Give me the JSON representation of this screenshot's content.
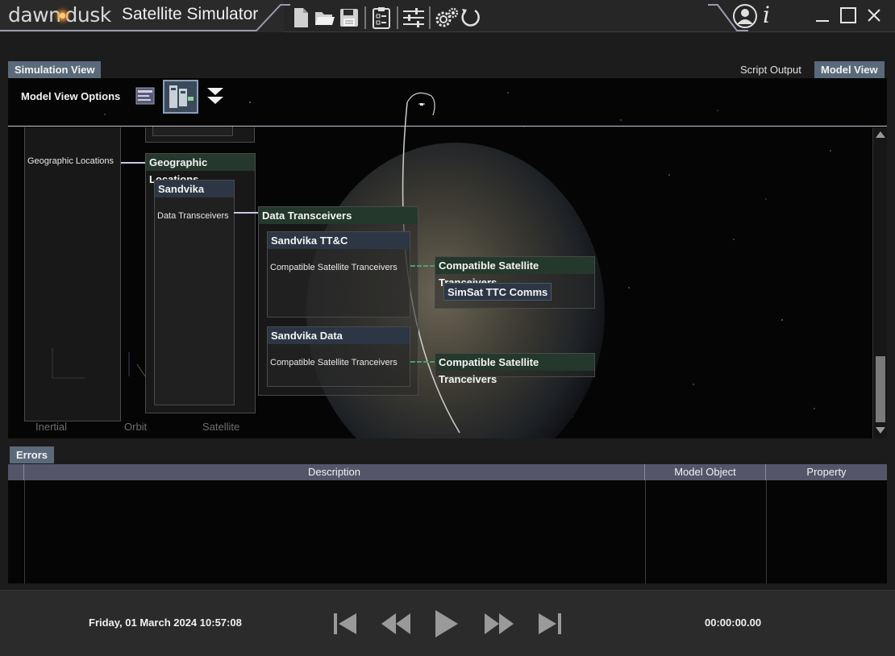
{
  "app": {
    "brand_left": "dawn",
    "brand_right": "dusk",
    "title": "Satellite Simulator"
  },
  "toolbar": {
    "icons": [
      "new-file-icon",
      "open-folder-icon",
      "save-icon",
      "clipboard-checklist-icon",
      "settings-sliders-icon",
      "gears-icon",
      "reset-icon"
    ]
  },
  "tabs": {
    "simulation_view": "Simulation View",
    "script_output": "Script Output",
    "model_view": "Model View",
    "errors": "Errors"
  },
  "model_view": {
    "options_label": "Model View Options",
    "column_labels": [
      "Inertial",
      "Orbit",
      "Satellite"
    ],
    "geo_link_label": "Geographic Locations",
    "geo_panel_title": "Geographic Locations",
    "sandvika_title": "Sandvika",
    "data_link_label": "Data Transceivers",
    "data_panel_title": "Data Transceivers",
    "ttc_title": "Sandvika TT&C",
    "ttc_link_label": "Compatible Satellite Tranceivers",
    "compat1_title": "Compatible Satellite Tranceivers",
    "simsat_chip": "SimSat TTC Comms",
    "data_title": "Sandvika Data",
    "data_sub_link_label": "Compatible Satellite Tranceivers",
    "compat2_title": "Compatible Satellite Tranceivers"
  },
  "errors_table": {
    "columns": [
      "Description",
      "Model Object",
      "Property"
    ],
    "rows": []
  },
  "playback": {
    "datetime": "Friday, 01 March 2024 10:57:08",
    "elapsed": "00:00:00.00"
  },
  "colors": {
    "accent_tab": "#5a6a7a",
    "panel_green": "#24382c",
    "panel_blue": "#2c3644",
    "table_header": "#55556a"
  }
}
